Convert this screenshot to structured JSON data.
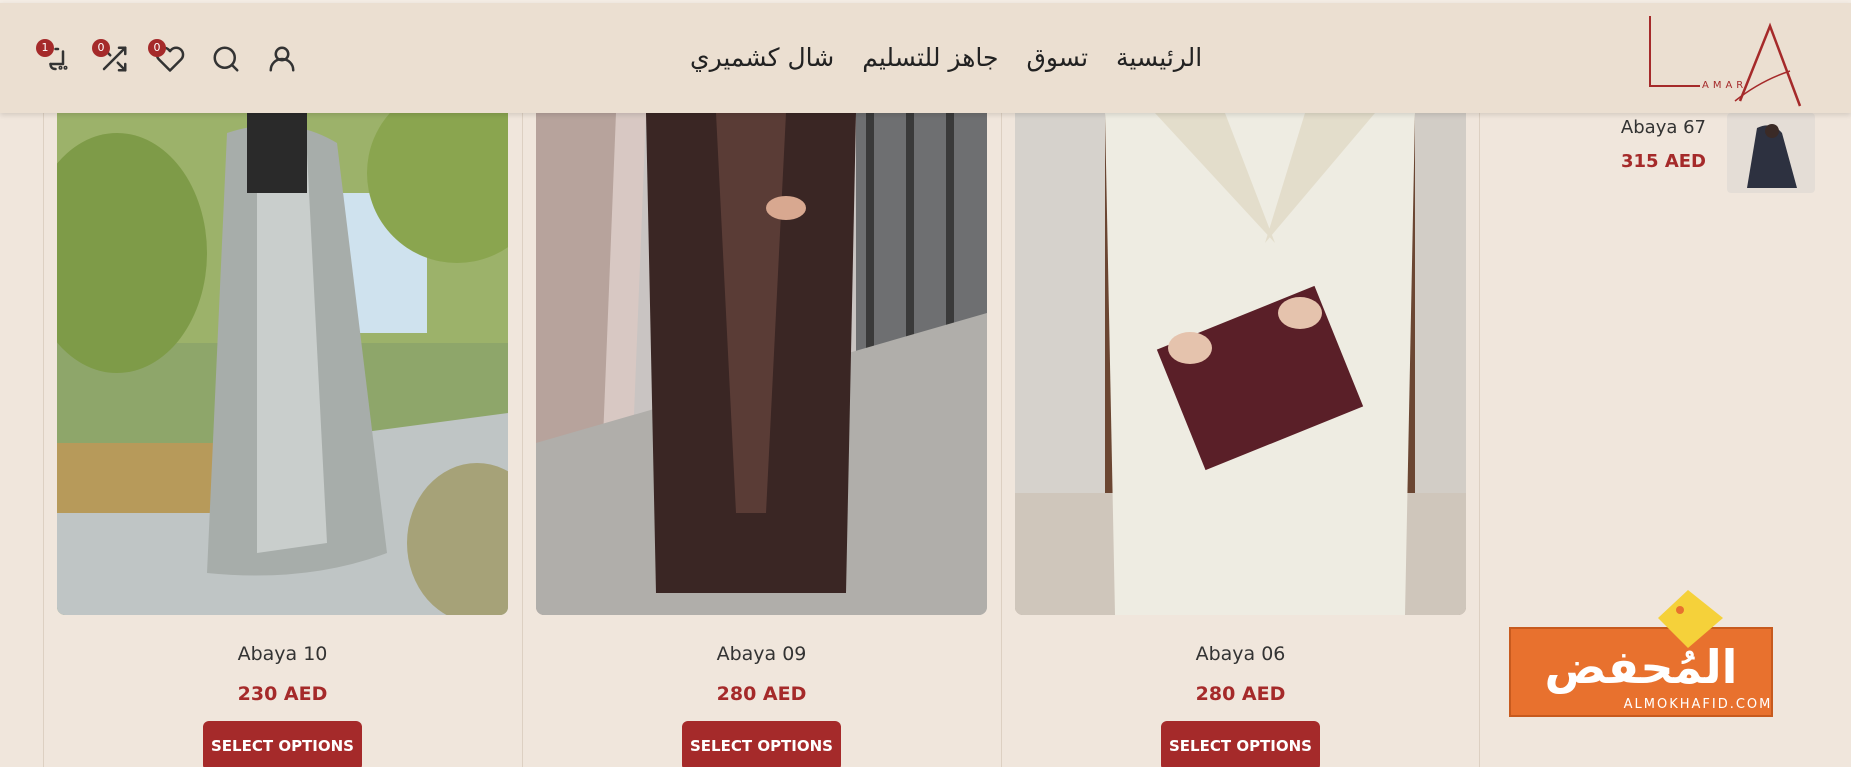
{
  "header": {
    "nav": [
      "الرئيسية",
      "تسوق",
      "جاهز للتسليم",
      "شال كشميري"
    ],
    "cart_count": "1",
    "compare_count": "0",
    "wishlist_count": "0",
    "logo_sub": "AMAR"
  },
  "products": [
    {
      "name": "Abaya 10",
      "price": "230 AED",
      "button": "SELECT OPTIONS"
    },
    {
      "name": "Abaya 09",
      "price": "280 AED",
      "button": "SELECT OPTIONS"
    },
    {
      "name": "Abaya 06",
      "price": "280 AED",
      "button": "SELECT OPTIONS"
    }
  ],
  "sidebar_product": {
    "name": "Abaya 67",
    "price": "315 AED"
  },
  "watermark": {
    "arabic": "المُحفض",
    "latin": "ALMOKHAFID.COM"
  },
  "colors": {
    "accent": "#a52a2a",
    "bg": "#f0e6dc",
    "header": "#ebdfd1"
  }
}
